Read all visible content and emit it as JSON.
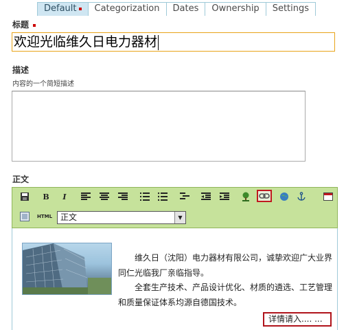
{
  "tabs": [
    {
      "label": "Default",
      "active": true,
      "required": true
    },
    {
      "label": "Categorization",
      "active": false
    },
    {
      "label": "Dates",
      "active": false
    },
    {
      "label": "Ownership",
      "active": false
    },
    {
      "label": "Settings",
      "active": false
    }
  ],
  "fields": {
    "title_label": "标题",
    "title_value": "欢迎光临维久日电力器材",
    "description_label": "描述",
    "description_help": "内容的一个简短描述",
    "description_value": "",
    "body_label": "正文"
  },
  "editor": {
    "toolbar_icons": [
      "save-icon",
      "bold-icon",
      "italic-icon",
      "align-left-icon",
      "align-center-icon",
      "align-right-icon",
      "ordered-list-icon",
      "unordered-list-icon",
      "definition-list-icon",
      "outdent-icon",
      "indent-icon",
      "image-icon",
      "link-icon",
      "external-link-icon",
      "anchor-icon",
      "table-icon",
      "html-icon"
    ],
    "bold_label": "B",
    "italic_label": "I",
    "html_label": "HTML",
    "format_select_value": "正文",
    "body_paragraph_1": "维久日（沈阳）电力器材有限公司，诚挚欢迎广大业界同仁光临我厂亲临指导。",
    "body_paragraph_2": "全套生产技术、产品设计优化、材质的遴选、工艺管理和质量保证体系均源自德国技术。",
    "more_link": "详情请入.... ..."
  },
  "colors": {
    "toolbar_bg": "#c6e29b",
    "tab_active_bg": "#cfe6f2",
    "required_marker": "#cc0000",
    "highlight_border": "#c0191f",
    "title_input_border": "#e8a317"
  }
}
